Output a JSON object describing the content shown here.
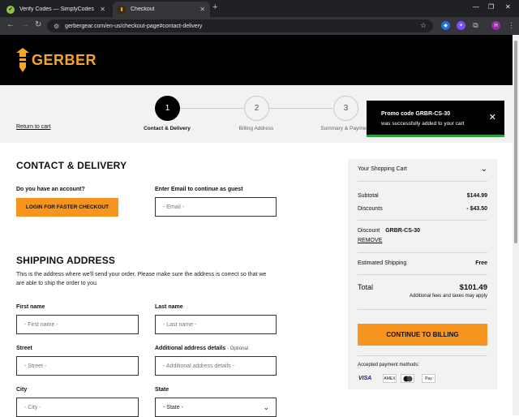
{
  "browser": {
    "tabs": [
      {
        "title": "Verify Codes — SimplyCodes",
        "active": false
      },
      {
        "title": "Checkout",
        "active": true
      }
    ],
    "url": "gerbergear.com/en-us/checkout-page#contact-delivery",
    "profile_initial": "H"
  },
  "header": {
    "brand": "GERBER"
  },
  "nav": {
    "return_label": "Return to cart"
  },
  "steps": [
    {
      "num": "1",
      "label": "Contact & Delivery"
    },
    {
      "num": "2",
      "label": "Billing Address"
    },
    {
      "num": "3",
      "label": "Summary & Payment"
    }
  ],
  "toast": {
    "line1": "Promo code GRBR-CS-30",
    "line2": "was successfully added to your cart"
  },
  "contact": {
    "heading": "CONTACT & DELIVERY",
    "account_label": "Do you have an account?",
    "login_button": "LOGIN FOR FASTER CHECKOUT",
    "email_label": "Enter Email to continue as guest",
    "email_placeholder": "- Email -"
  },
  "shipping": {
    "heading": "SHIPPING ADDRESS",
    "description": "This is the address where we'll send your order. Please make sure the address is correct so that we are able to ship the order to you.",
    "first_name_label": "First name",
    "first_name_placeholder": "- First name -",
    "last_name_label": "Last name",
    "last_name_placeholder": "- Last name -",
    "street_label": "Street",
    "street_placeholder": "- Street -",
    "addl_label": "Additional address details",
    "addl_optional": "- Optional",
    "addl_placeholder": "- Additional address details -",
    "city_label": "City",
    "city_placeholder": "- City -",
    "state_label": "State",
    "state_value": "- State -"
  },
  "cart": {
    "title": "Your Shopping Cart",
    "subtotal_label": "Subtotal",
    "subtotal_value": "$144.99",
    "discounts_label": "Discounts",
    "discounts_value": "- $43.50",
    "discount_label": "Discount",
    "discount_code": "GRBR-CS-30",
    "remove_label": "REMOVE",
    "shipping_label": "Estimated Shipping",
    "shipping_value": "Free",
    "total_label": "Total",
    "total_value": "$101.49",
    "fees_note": "Additional fees and taxes may apply",
    "checkout_button": "CONTINUE TO BILLING",
    "payment_label": "Accepted payment methods:",
    "payment_methods": [
      "VISA",
      "AMEX",
      "MC",
      "Pay"
    ]
  }
}
